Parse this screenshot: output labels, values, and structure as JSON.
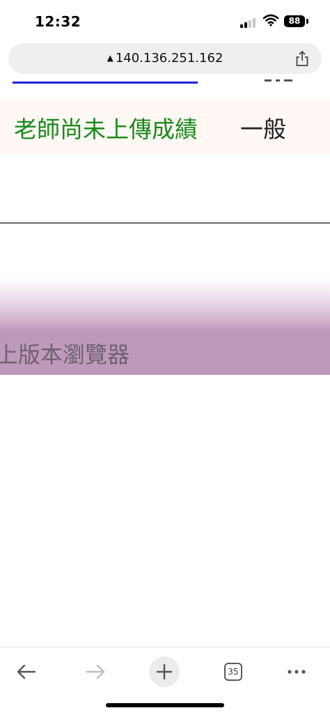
{
  "status_bar": {
    "time": "12:32",
    "battery": "88",
    "icons": [
      "signal-icon",
      "wifi-icon",
      "battery-icon"
    ]
  },
  "address_bar": {
    "url": "140.136.251.162",
    "icons": [
      "warning-icon",
      "share-icon"
    ]
  },
  "page": {
    "grade_status": "老師尚未上傳成績",
    "grade_type": "一般",
    "browser_notice": "上版本瀏覽器",
    "colors": {
      "status_text": "#1a8a1a",
      "link": "#1a22d4",
      "notice_band": "#bf99bc"
    }
  },
  "toolbar": {
    "tab_count": "35",
    "icons": [
      "back-arrow-icon",
      "forward-arrow-icon",
      "plus-icon",
      "tabs-icon",
      "more-icon"
    ]
  }
}
